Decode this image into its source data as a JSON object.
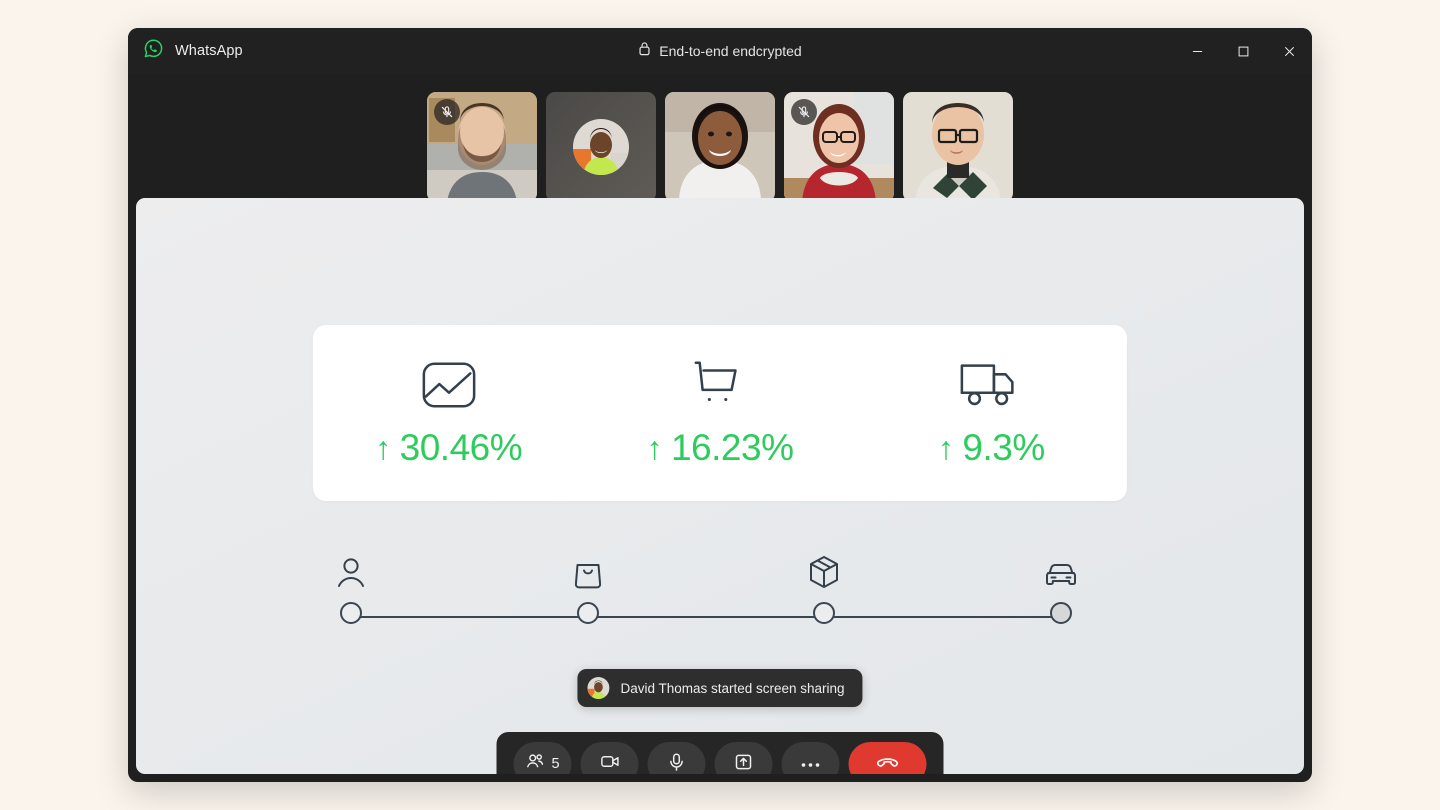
{
  "window": {
    "app_name": "WhatsApp",
    "logo_icon": "whatsapp-logo-icon",
    "encryption_label": "End-to-end endcrypted",
    "lock_icon": "lock-icon",
    "controls": {
      "minimize": "minimize-icon",
      "maximize": "maximize-icon",
      "close": "close-icon"
    },
    "background_color": "#faf4ec",
    "chrome_color": "#1f1f1f"
  },
  "participants": [
    {
      "name": "participant-1",
      "muted": true,
      "video": true,
      "avatar": false
    },
    {
      "name": "participant-2",
      "muted": false,
      "video": false,
      "avatar": true
    },
    {
      "name": "participant-3",
      "muted": false,
      "video": true,
      "avatar": false
    },
    {
      "name": "participant-4",
      "muted": true,
      "video": true,
      "avatar": false
    },
    {
      "name": "participant-5",
      "muted": false,
      "video": true,
      "avatar": false
    }
  ],
  "shared_screen": {
    "metrics": [
      {
        "icon": "chart-image-icon",
        "arrow": "↑",
        "value": "30.46%"
      },
      {
        "icon": "shopping-cart-icon",
        "arrow": "↑",
        "value": "16.23%"
      },
      {
        "icon": "delivery-truck-icon",
        "arrow": "↑",
        "value": "9.3%"
      }
    ],
    "metric_color": "#2ecc5e",
    "icon_color": "#35404d",
    "stepper": [
      {
        "icon": "person-icon",
        "filled": false
      },
      {
        "icon": "shopping-bag-icon",
        "filled": false
      },
      {
        "icon": "package-box-icon",
        "filled": false
      },
      {
        "icon": "car-icon",
        "filled": true
      }
    ]
  },
  "toast": {
    "avatar_icon": "user-avatar",
    "message": "David Thomas started screen sharing"
  },
  "controls": {
    "participants_count": "5",
    "participants_icon": "people-icon",
    "camera_icon": "video-camera-icon",
    "mic_icon": "microphone-icon",
    "share_icon": "share-screen-icon",
    "more_icon": "more-options-icon",
    "end_call_icon": "end-call-icon",
    "end_call_color": "#e0392f"
  }
}
